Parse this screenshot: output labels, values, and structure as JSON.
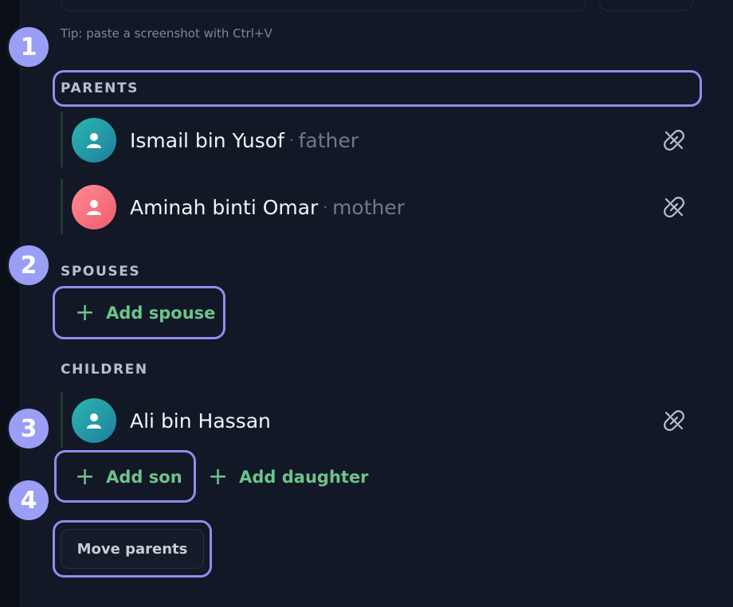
{
  "tip": "Tip: paste a screenshot with Ctrl+V",
  "sections": {
    "parents": "PARENTS",
    "spouses": "SPOUSES",
    "children": "CHILDREN"
  },
  "parents": [
    {
      "name": "Ismail bin Yusof",
      "separator": "·",
      "role": "father",
      "gender": "male"
    },
    {
      "name": "Aminah binti Omar",
      "separator": "·",
      "role": "mother",
      "gender": "female"
    }
  ],
  "children": [
    {
      "name": "Ali bin Hassan",
      "gender": "male"
    }
  ],
  "buttons": {
    "add_spouse": "Add spouse",
    "add_son": "Add son",
    "add_daughter": "Add daughter",
    "move_parents": "Move parents",
    "plus": "+"
  },
  "badges": [
    "1",
    "2",
    "3",
    "4"
  ],
  "icons": {
    "avatar": "person-icon",
    "unlink": "unlink-icon",
    "add": "plus-icon"
  },
  "colors": {
    "background": "#121826",
    "highlight": "#8b8ff0",
    "badge": "#9a9ef5",
    "add_green": "#6cc48a",
    "male_avatar": "#2bb7b0",
    "female_avatar": "#ff6b7a"
  }
}
